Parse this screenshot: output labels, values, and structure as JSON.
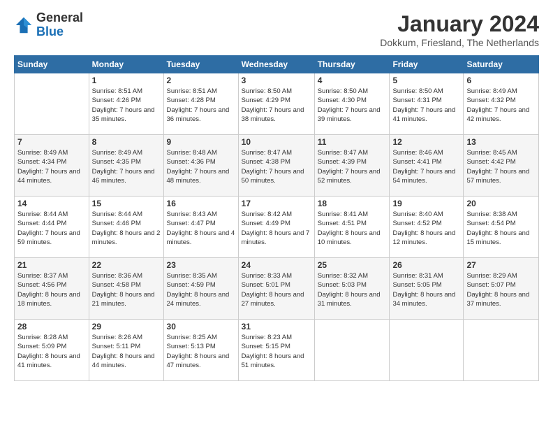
{
  "logo": {
    "general": "General",
    "blue": "Blue"
  },
  "title": "January 2024",
  "location": "Dokkum, Friesland, The Netherlands",
  "days_of_week": [
    "Sunday",
    "Monday",
    "Tuesday",
    "Wednesday",
    "Thursday",
    "Friday",
    "Saturday"
  ],
  "weeks": [
    [
      {
        "day": "",
        "sunrise": "",
        "sunset": "",
        "daylight": ""
      },
      {
        "day": "1",
        "sunrise": "Sunrise: 8:51 AM",
        "sunset": "Sunset: 4:26 PM",
        "daylight": "Daylight: 7 hours and 35 minutes."
      },
      {
        "day": "2",
        "sunrise": "Sunrise: 8:51 AM",
        "sunset": "Sunset: 4:28 PM",
        "daylight": "Daylight: 7 hours and 36 minutes."
      },
      {
        "day": "3",
        "sunrise": "Sunrise: 8:50 AM",
        "sunset": "Sunset: 4:29 PM",
        "daylight": "Daylight: 7 hours and 38 minutes."
      },
      {
        "day": "4",
        "sunrise": "Sunrise: 8:50 AM",
        "sunset": "Sunset: 4:30 PM",
        "daylight": "Daylight: 7 hours and 39 minutes."
      },
      {
        "day": "5",
        "sunrise": "Sunrise: 8:50 AM",
        "sunset": "Sunset: 4:31 PM",
        "daylight": "Daylight: 7 hours and 41 minutes."
      },
      {
        "day": "6",
        "sunrise": "Sunrise: 8:49 AM",
        "sunset": "Sunset: 4:32 PM",
        "daylight": "Daylight: 7 hours and 42 minutes."
      }
    ],
    [
      {
        "day": "7",
        "sunrise": "Sunrise: 8:49 AM",
        "sunset": "Sunset: 4:34 PM",
        "daylight": "Daylight: 7 hours and 44 minutes."
      },
      {
        "day": "8",
        "sunrise": "Sunrise: 8:49 AM",
        "sunset": "Sunset: 4:35 PM",
        "daylight": "Daylight: 7 hours and 46 minutes."
      },
      {
        "day": "9",
        "sunrise": "Sunrise: 8:48 AM",
        "sunset": "Sunset: 4:36 PM",
        "daylight": "Daylight: 7 hours and 48 minutes."
      },
      {
        "day": "10",
        "sunrise": "Sunrise: 8:47 AM",
        "sunset": "Sunset: 4:38 PM",
        "daylight": "Daylight: 7 hours and 50 minutes."
      },
      {
        "day": "11",
        "sunrise": "Sunrise: 8:47 AM",
        "sunset": "Sunset: 4:39 PM",
        "daylight": "Daylight: 7 hours and 52 minutes."
      },
      {
        "day": "12",
        "sunrise": "Sunrise: 8:46 AM",
        "sunset": "Sunset: 4:41 PM",
        "daylight": "Daylight: 7 hours and 54 minutes."
      },
      {
        "day": "13",
        "sunrise": "Sunrise: 8:45 AM",
        "sunset": "Sunset: 4:42 PM",
        "daylight": "Daylight: 7 hours and 57 minutes."
      }
    ],
    [
      {
        "day": "14",
        "sunrise": "Sunrise: 8:44 AM",
        "sunset": "Sunset: 4:44 PM",
        "daylight": "Daylight: 7 hours and 59 minutes."
      },
      {
        "day": "15",
        "sunrise": "Sunrise: 8:44 AM",
        "sunset": "Sunset: 4:46 PM",
        "daylight": "Daylight: 8 hours and 2 minutes."
      },
      {
        "day": "16",
        "sunrise": "Sunrise: 8:43 AM",
        "sunset": "Sunset: 4:47 PM",
        "daylight": "Daylight: 8 hours and 4 minutes."
      },
      {
        "day": "17",
        "sunrise": "Sunrise: 8:42 AM",
        "sunset": "Sunset: 4:49 PM",
        "daylight": "Daylight: 8 hours and 7 minutes."
      },
      {
        "day": "18",
        "sunrise": "Sunrise: 8:41 AM",
        "sunset": "Sunset: 4:51 PM",
        "daylight": "Daylight: 8 hours and 10 minutes."
      },
      {
        "day": "19",
        "sunrise": "Sunrise: 8:40 AM",
        "sunset": "Sunset: 4:52 PM",
        "daylight": "Daylight: 8 hours and 12 minutes."
      },
      {
        "day": "20",
        "sunrise": "Sunrise: 8:38 AM",
        "sunset": "Sunset: 4:54 PM",
        "daylight": "Daylight: 8 hours and 15 minutes."
      }
    ],
    [
      {
        "day": "21",
        "sunrise": "Sunrise: 8:37 AM",
        "sunset": "Sunset: 4:56 PM",
        "daylight": "Daylight: 8 hours and 18 minutes."
      },
      {
        "day": "22",
        "sunrise": "Sunrise: 8:36 AM",
        "sunset": "Sunset: 4:58 PM",
        "daylight": "Daylight: 8 hours and 21 minutes."
      },
      {
        "day": "23",
        "sunrise": "Sunrise: 8:35 AM",
        "sunset": "Sunset: 4:59 PM",
        "daylight": "Daylight: 8 hours and 24 minutes."
      },
      {
        "day": "24",
        "sunrise": "Sunrise: 8:33 AM",
        "sunset": "Sunset: 5:01 PM",
        "daylight": "Daylight: 8 hours and 27 minutes."
      },
      {
        "day": "25",
        "sunrise": "Sunrise: 8:32 AM",
        "sunset": "Sunset: 5:03 PM",
        "daylight": "Daylight: 8 hours and 31 minutes."
      },
      {
        "day": "26",
        "sunrise": "Sunrise: 8:31 AM",
        "sunset": "Sunset: 5:05 PM",
        "daylight": "Daylight: 8 hours and 34 minutes."
      },
      {
        "day": "27",
        "sunrise": "Sunrise: 8:29 AM",
        "sunset": "Sunset: 5:07 PM",
        "daylight": "Daylight: 8 hours and 37 minutes."
      }
    ],
    [
      {
        "day": "28",
        "sunrise": "Sunrise: 8:28 AM",
        "sunset": "Sunset: 5:09 PM",
        "daylight": "Daylight: 8 hours and 41 minutes."
      },
      {
        "day": "29",
        "sunrise": "Sunrise: 8:26 AM",
        "sunset": "Sunset: 5:11 PM",
        "daylight": "Daylight: 8 hours and 44 minutes."
      },
      {
        "day": "30",
        "sunrise": "Sunrise: 8:25 AM",
        "sunset": "Sunset: 5:13 PM",
        "daylight": "Daylight: 8 hours and 47 minutes."
      },
      {
        "day": "31",
        "sunrise": "Sunrise: 8:23 AM",
        "sunset": "Sunset: 5:15 PM",
        "daylight": "Daylight: 8 hours and 51 minutes."
      },
      {
        "day": "",
        "sunrise": "",
        "sunset": "",
        "daylight": ""
      },
      {
        "day": "",
        "sunrise": "",
        "sunset": "",
        "daylight": ""
      },
      {
        "day": "",
        "sunrise": "",
        "sunset": "",
        "daylight": ""
      }
    ]
  ]
}
